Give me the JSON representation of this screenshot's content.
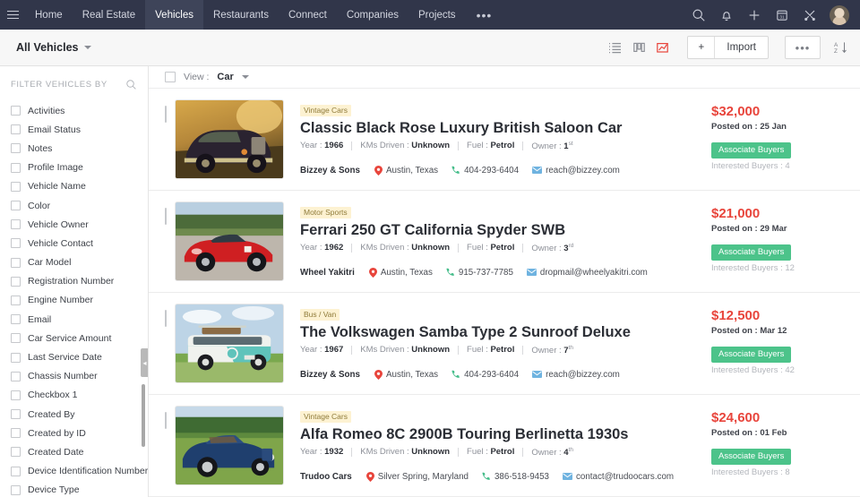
{
  "topnav": {
    "menu_icon": "hamburger-icon",
    "items": [
      {
        "label": "Home",
        "active": false
      },
      {
        "label": "Real Estate",
        "active": false
      },
      {
        "label": "Vehicles",
        "active": true
      },
      {
        "label": "Restaurants",
        "active": false
      },
      {
        "label": "Connect",
        "active": false
      },
      {
        "label": "Companies",
        "active": false
      },
      {
        "label": "Projects",
        "active": false
      }
    ],
    "more_label": "•••",
    "icons": [
      "search-icon",
      "notification-bell-icon",
      "add-icon",
      "calendar-icon",
      "tools-icon"
    ],
    "avatar": "user-avatar"
  },
  "subheader": {
    "title": "All Vehicles",
    "view_icons": [
      "list-view-icon",
      "kanban-view-icon",
      "chart-view-icon"
    ],
    "add_label": "+",
    "import_label": "Import",
    "more_label": "•••",
    "sort_label": "sort-az-icon",
    "accent_active": "#e8453c"
  },
  "sidebar": {
    "heading": "FILTER VEHICLES BY",
    "search_icon": "search-icon",
    "items": [
      {
        "label": "Activities"
      },
      {
        "label": "Email Status"
      },
      {
        "label": "Notes"
      },
      {
        "label": "Profile Image"
      },
      {
        "label": "Vehicle Name"
      },
      {
        "label": "Color"
      },
      {
        "label": "Vehicle Owner"
      },
      {
        "label": "Vehicle Contact"
      },
      {
        "label": "Car Model"
      },
      {
        "label": "Registration Number"
      },
      {
        "label": "Engine Number"
      },
      {
        "label": "Email"
      },
      {
        "label": "Car Service Amount"
      },
      {
        "label": "Last Service Date"
      },
      {
        "label": "Chassis Number"
      },
      {
        "label": "Checkbox 1"
      },
      {
        "label": "Created By"
      },
      {
        "label": "Created by ID"
      },
      {
        "label": "Created Date"
      },
      {
        "label": "Device Identification Number"
      },
      {
        "label": "Device Type"
      }
    ]
  },
  "list_header": {
    "view_label": "View :",
    "view_value": "Car"
  },
  "cards": [
    {
      "tag": "Vintage Cars",
      "title": "Classic Black Rose Luxury British Saloon Car",
      "year_label": "Year :",
      "year": "1966",
      "kms_label": "KMs Driven :",
      "kms": "Unknown",
      "fuel_label": "Fuel :",
      "fuel": "Petrol",
      "owner_label": "Owner :",
      "owner": "1",
      "owner_sup": "st",
      "dealer": "Bizzey & Sons",
      "location": "Austin, Texas",
      "phone": "404-293-6404",
      "email": "reach@bizzey.com",
      "price": "$32,000",
      "posted": "Posted on : 25 Jan",
      "associate_label": "Associate Buyers",
      "interested": "Interested Buyers : 4",
      "image": "vintage-black-car-sunset"
    },
    {
      "tag": "Motor Sports",
      "title": "Ferrari 250 GT California Spyder SWB",
      "year_label": "Year :",
      "year": "1962",
      "kms_label": "KMs Driven :",
      "kms": "Unknown",
      "fuel_label": "Fuel :",
      "fuel": "Petrol",
      "owner_label": "Owner :",
      "owner": "3",
      "owner_sup": "rd",
      "dealer": "Wheel Yakitri",
      "location": "Austin, Texas",
      "phone": "915-737-7785",
      "email": "dropmail@wheelyakitri.com",
      "price": "$21,000",
      "posted": "Posted on : 29 Mar",
      "associate_label": "Associate Buyers",
      "interested": "Interested Buyers : 12",
      "image": "red-ferrari-convertible"
    },
    {
      "tag": "Bus / Van",
      "title": "The Volkswagen Samba Type 2 Sunroof Deluxe",
      "year_label": "Year :",
      "year": "1967",
      "kms_label": "KMs Driven :",
      "kms": "Unknown",
      "fuel_label": "Fuel :",
      "fuel": "Petrol",
      "owner_label": "Owner :",
      "owner": "7",
      "owner_sup": "th",
      "dealer": "Bizzey & Sons",
      "location": "Austin, Texas",
      "phone": "404-293-6404",
      "email": "reach@bizzey.com",
      "price": "$12,500",
      "posted": "Posted on : Mar 12",
      "associate_label": "Associate Buyers",
      "interested": "Interested Buyers : 42",
      "image": "teal-vw-bus"
    },
    {
      "tag": "Vintage Cars",
      "title": "Alfa Romeo 8C 2900B Touring Berlinetta 1930s",
      "year_label": "Year :",
      "year": "1932",
      "kms_label": "KMs Driven :",
      "kms": "Unknown",
      "fuel_label": "Fuel :",
      "fuel": "Petrol",
      "owner_label": "Owner :",
      "owner": "4",
      "owner_sup": "th",
      "dealer": "Trudoo Cars",
      "location": "Silver Spring, Maryland",
      "phone": "386-518-9453",
      "email": "contact@trudoocars.com",
      "price": "$24,600",
      "posted": "Posted on : 01 Feb",
      "associate_label": "Associate Buyers",
      "interested": "Interested Buyers : 8",
      "image": "blue-alfa-romeo"
    }
  ],
  "colors": {
    "nav_bg": "#31364a",
    "price": "#e8453c",
    "associate": "#4cc38a",
    "tag_bg": "#fdf2d2",
    "tag_text": "#8f7b3a"
  }
}
